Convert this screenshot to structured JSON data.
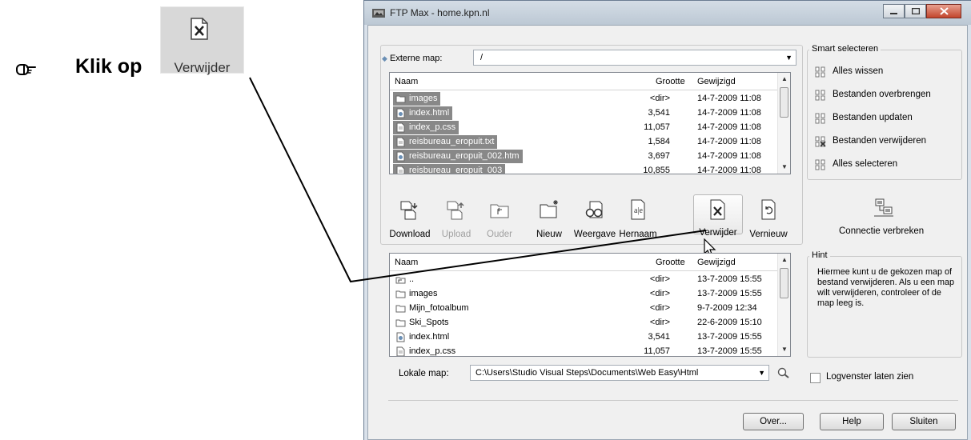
{
  "instruction": {
    "text": "Klik op",
    "button_label": "Verwijder"
  },
  "window": {
    "title": "FTP Max - home.kpn.nl"
  },
  "remote": {
    "label": "Externe map:",
    "path": "/",
    "columns": [
      "Naam",
      "Grootte",
      "Gewijzigd"
    ],
    "files": [
      {
        "name": "images",
        "size": "<dir>",
        "date": "14-7-2009 11:08",
        "icon": "folder-icon"
      },
      {
        "name": "index.html",
        "size": "3,541",
        "date": "14-7-2009 11:08",
        "icon": "html-file-icon"
      },
      {
        "name": "index_p.css",
        "size": "11,057",
        "date": "14-7-2009 11:08",
        "icon": "file-icon"
      },
      {
        "name": "reisbureau_eropuit.txt",
        "size": "1,584",
        "date": "14-7-2009 11:08",
        "icon": "file-icon"
      },
      {
        "name": "reisbureau_eropuit_002.htm",
        "size": "3,697",
        "date": "14-7-2009 11:08",
        "icon": "html-file-icon"
      },
      {
        "name": "reisbureau_eropuit_003",
        "size": "10,855",
        "date": "14-7-2009 11:08",
        "icon": "file-icon"
      }
    ]
  },
  "toolbar": {
    "download": "Download",
    "upload": "Upload",
    "ouder": "Ouder",
    "nieuw": "Nieuw",
    "weergave": "Weergave",
    "hernaam": "Hernaam",
    "verwijder": "Verwijder",
    "vernieuw": "Vernieuw"
  },
  "local": {
    "columns": [
      "Naam",
      "Grootte",
      "Gewijzigd"
    ],
    "files": [
      {
        "name": "..",
        "size": "<dir>",
        "date": "13-7-2009 15:55",
        "icon": "parent-folder-icon"
      },
      {
        "name": "images",
        "size": "<dir>",
        "date": "13-7-2009 15:55",
        "icon": "folder-icon"
      },
      {
        "name": "Mijn_fotoalbum",
        "size": "<dir>",
        "date": "9-7-2009 12:34",
        "icon": "folder-icon"
      },
      {
        "name": "Ski_Spots",
        "size": "<dir>",
        "date": "22-6-2009 15:10",
        "icon": "folder-icon"
      },
      {
        "name": "index.html",
        "size": "3,541",
        "date": "13-7-2009 15:55",
        "icon": "html-file-icon"
      },
      {
        "name": "index_p.css",
        "size": "11,057",
        "date": "13-7-2009 15:55",
        "icon": "file-icon"
      }
    ],
    "map_label": "Lokale map:",
    "map_path": "C:\\Users\\Studio Visual Steps\\Documents\\Web Easy\\Html"
  },
  "smart": {
    "title": "Smart selecteren",
    "items": [
      "Alles wissen",
      "Bestanden overbrengen",
      "Bestanden updaten",
      "Bestanden verwijderen",
      "Alles selecteren"
    ]
  },
  "connection": {
    "label": "Connectie verbreken"
  },
  "hint": {
    "title": "Hint",
    "text": "Hiermee kunt u de gekozen map of bestand verwijderen. Als u een map wilt verwijderen, controleer of de map leeg is."
  },
  "log": {
    "label": "Logvenster laten zien"
  },
  "buttons": {
    "over": "Over...",
    "help": "Help",
    "close": "Sluiten"
  },
  "colors": {
    "selection": "#888888",
    "title_gradient_top": "#d4dde6",
    "close_button": "#c2452d"
  }
}
